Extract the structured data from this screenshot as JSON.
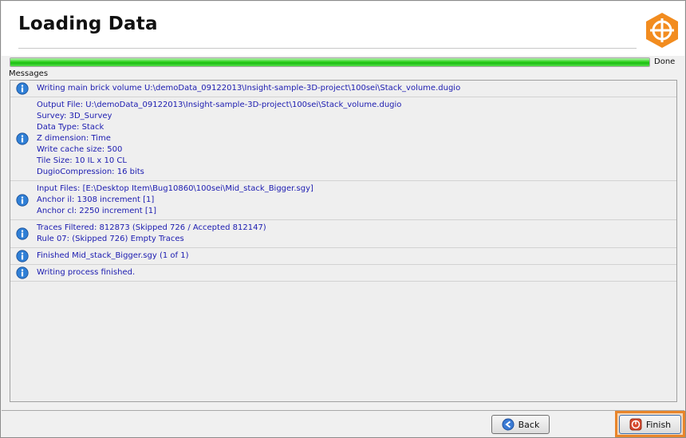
{
  "header": {
    "title": "Loading Data",
    "logo_icon": "crosshair-logo-icon",
    "logo_color": "#f28c1f"
  },
  "progress": {
    "fraction": 1.0,
    "status": "Done",
    "color": "#2fd31f"
  },
  "messages": {
    "label": "Messages",
    "items": [
      {
        "icon": "info-icon",
        "lines": [
          "Writing main brick volume U:\\demoData_09122013\\Insight-sample-3D-project\\100sei\\Stack_volume.dugio"
        ]
      },
      {
        "icon": "info-icon",
        "lines": [
          "Output File: U:\\demoData_09122013\\Insight-sample-3D-project\\100sei\\Stack_volume.dugio",
          "Survey: 3D_Survey",
          "Data Type: Stack",
          "Z dimension: Time",
          "Write cache size: 500",
          "Tile Size: 10 IL x 10 CL",
          "DugioCompression: 16 bits"
        ]
      },
      {
        "icon": "info-icon",
        "lines": [
          "Input Files: [E:\\Desktop Item\\Bug10860\\100sei\\Mid_stack_Bigger.sgy]",
          "Anchor il: 1308 increment [1]",
          "Anchor cl: 2250 increment [1]"
        ]
      },
      {
        "icon": "info-icon",
        "lines": [
          "Traces Filtered: 812873 (Skipped 726 / Accepted 812147)",
          "Rule 07: (Skipped 726) Empty Traces"
        ]
      },
      {
        "icon": "info-icon",
        "lines": [
          "Finished Mid_stack_Bigger.sgy (1 of 1)"
        ]
      },
      {
        "icon": "info-icon",
        "lines": [
          "Writing process finished."
        ]
      }
    ]
  },
  "footer": {
    "back_label": "Back",
    "back_icon": "back-arrow-icon",
    "finish_label": "Finish",
    "finish_icon": "finish-icon",
    "highlight_color": "#e8852b"
  }
}
